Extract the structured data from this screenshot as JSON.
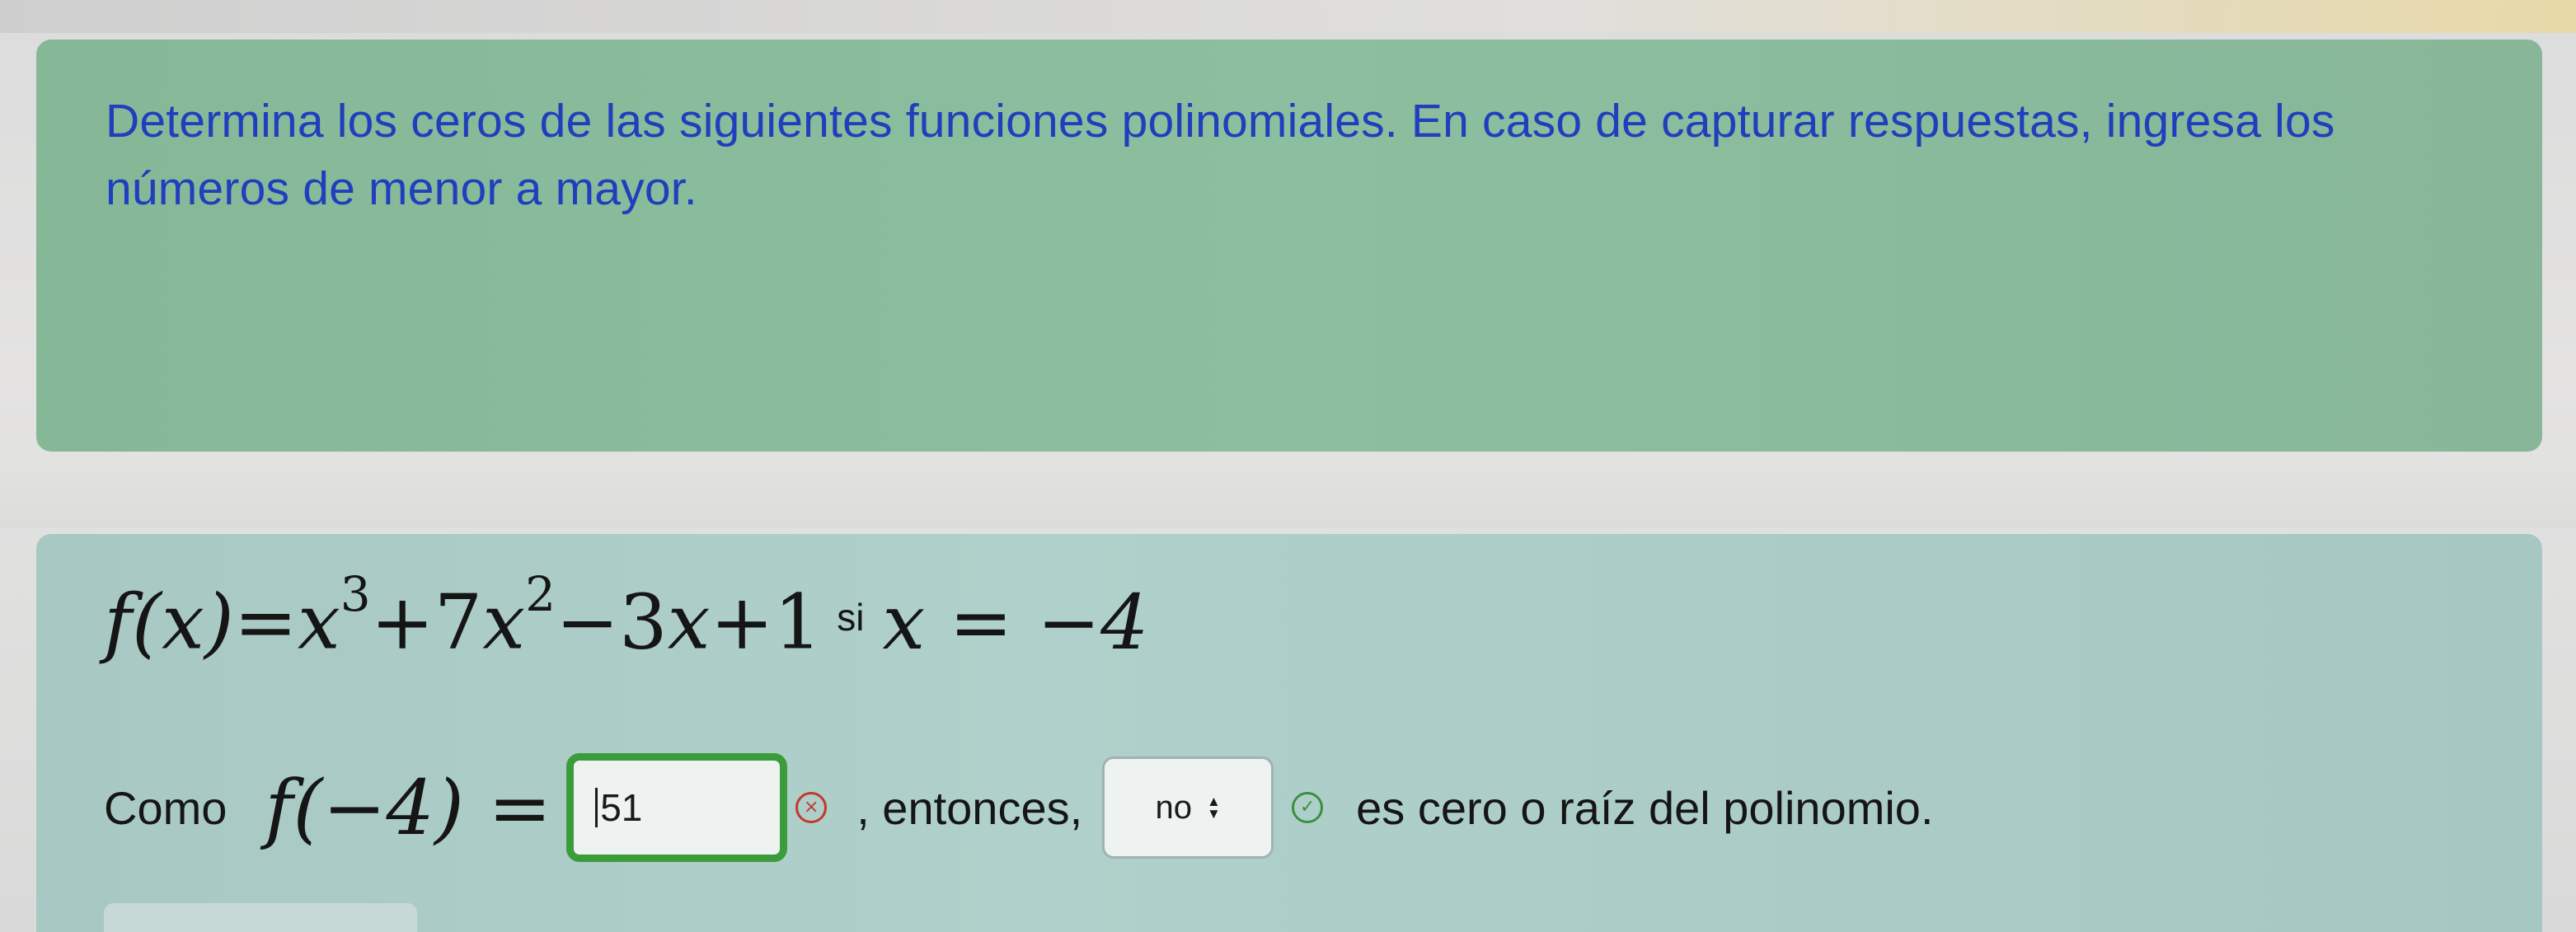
{
  "instructions": {
    "text": "Determina los ceros de las siguientes funciones polinomiales. En caso de capturar respuestas, ingresa los números de menor a mayor."
  },
  "problem": {
    "fx": "f(x)",
    "equals": "=",
    "x": "x",
    "exp3": "3",
    "plus7x": "+7",
    "exp2": "2",
    "minus3x": "−3",
    "plus1": "+1",
    "si_label": "si",
    "x_equals": "x = −4"
  },
  "answer": {
    "como_label": "Como",
    "f_of_neg4": "f(−4) =",
    "input_value": "51",
    "entonces_label": ", entonces,",
    "select_value": "no",
    "suffix_text": "es cero o raíz del polinomio.",
    "input_status": "incorrect",
    "select_status": "correct",
    "wrong_glyph": "×",
    "correct_glyph": "✓",
    "select_arrow_up": "▲",
    "select_arrow_down": "▼"
  },
  "colors": {
    "instructions_bg": "#8cbf9f",
    "instructions_text": "#1f3fbd",
    "exercise_bg": "#b0d0cb",
    "input_border": "#3a9c3a",
    "wrong_icon": "#c0392b",
    "correct_icon": "#3b8e3b"
  }
}
